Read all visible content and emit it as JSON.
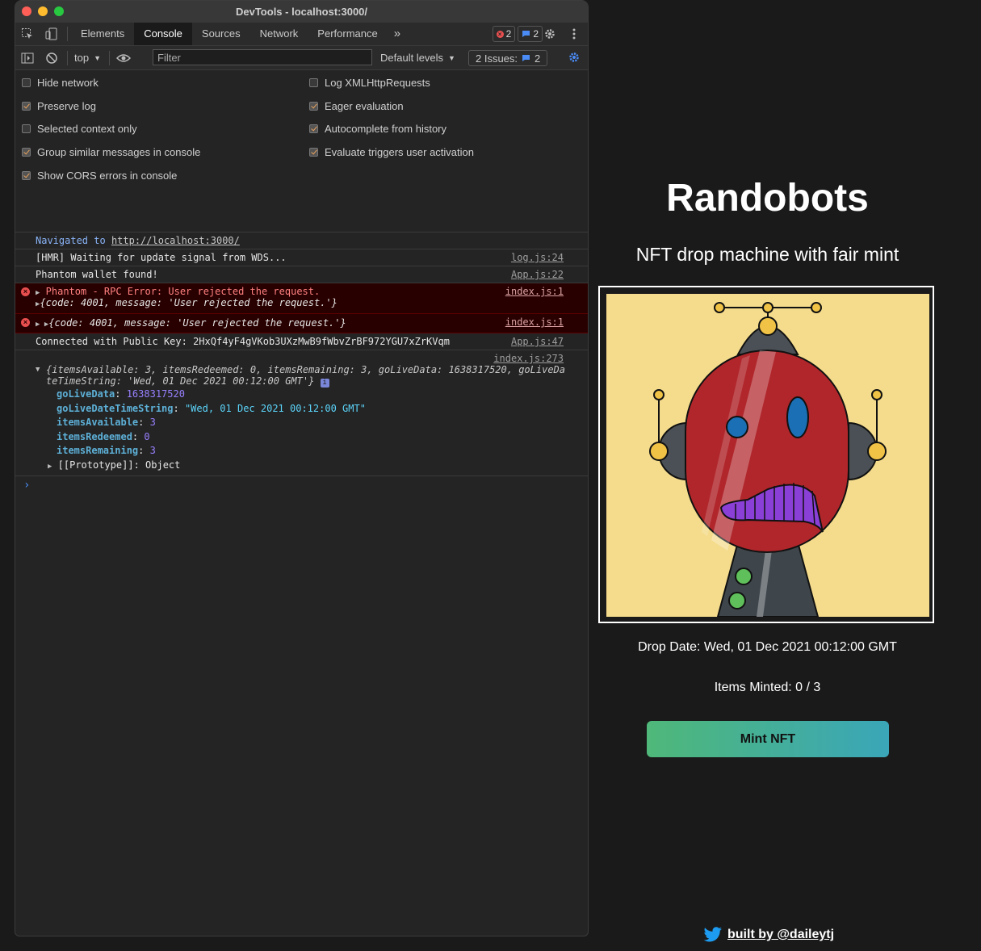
{
  "devtools": {
    "window_title": "DevTools - localhost:3000/",
    "tabs": [
      "Elements",
      "Console",
      "Sources",
      "Network",
      "Performance"
    ],
    "active_tab": "Console",
    "more_tabs": "»",
    "error_count": "2",
    "info_count": "2",
    "context": "top",
    "filter_placeholder": "Filter",
    "levels": "Default levels",
    "issues_label": "2 Issues:",
    "issues_count": "2",
    "settings_left": [
      {
        "label": "Hide network",
        "checked": false
      },
      {
        "label": "Preserve log",
        "checked": true
      },
      {
        "label": "Selected context only",
        "checked": false
      },
      {
        "label": "Group similar messages in console",
        "checked": true
      },
      {
        "label": "Show CORS errors in console",
        "checked": true
      }
    ],
    "settings_right": [
      {
        "label": "Log XMLHttpRequests",
        "checked": false
      },
      {
        "label": "Eager evaluation",
        "checked": true
      },
      {
        "label": "Autocomplete from history",
        "checked": true
      },
      {
        "label": "Evaluate triggers user activation",
        "checked": true
      }
    ],
    "log": {
      "navigated_prefix": "Navigated to",
      "navigated_url": "http://localhost:3000/",
      "hmr": "[HMR] Waiting for update signal from WDS...",
      "hmr_src": "log.js:24",
      "phantom_found": "Phantom wallet found!",
      "phantom_found_src": "App.js:22",
      "rpc_error": "Phantom - RPC Error: User rejected the request.",
      "rpc_error_src": "index.js:1",
      "rpc_error_obj": "{code: 4001, message: 'User rejected the request.'}",
      "rpc_error2_obj": "{code: 4001, message: 'User rejected the request.'}",
      "rpc_error2_src": "index.js:1",
      "connected": "Connected with Public Key: 2HxQf4yF4gVKob3UXzMwB9fWbvZrBF972YGU7xZrKVqm",
      "connected_src": "App.js:47",
      "obj_src": "index.js:273",
      "obj_summary_1": "{itemsAvailable: 3, itemsRedeemed: 0, itemsRemaining: 3, goLiveData: 1638317520, goLiveDa",
      "obj_summary_2": "teTimeString: 'Wed, 01 Dec 2021 00:12:00 GMT'}",
      "fields": [
        {
          "key": "goLiveData",
          "value": "1638317520",
          "kind": "num"
        },
        {
          "key": "goLiveDateTimeString",
          "value": "\"Wed, 01 Dec 2021 00:12:00 GMT\"",
          "kind": "str"
        },
        {
          "key": "itemsAvailable",
          "value": "3",
          "kind": "num"
        },
        {
          "key": "itemsRedeemed",
          "value": "0",
          "kind": "num"
        },
        {
          "key": "itemsRemaining",
          "value": "3",
          "kind": "num"
        }
      ],
      "prototype": "[[Prototype]]: Object",
      "prompt": "›"
    }
  },
  "app": {
    "title": "Randobots",
    "subtitle": "NFT drop machine with fair mint",
    "drop_date": "Drop Date: Wed, 01 Dec 2021 00:12:00 GMT",
    "items_minted": "Items Minted: 0 / 3",
    "mint_button": "Mint NFT",
    "footer_link": "built by @daileytj",
    "colors": {
      "background": "#1a1a1a",
      "nft_bg": "#f5dc8c",
      "robot_red": "#b0262b",
      "mouth_purple": "#8a3fd6"
    }
  }
}
